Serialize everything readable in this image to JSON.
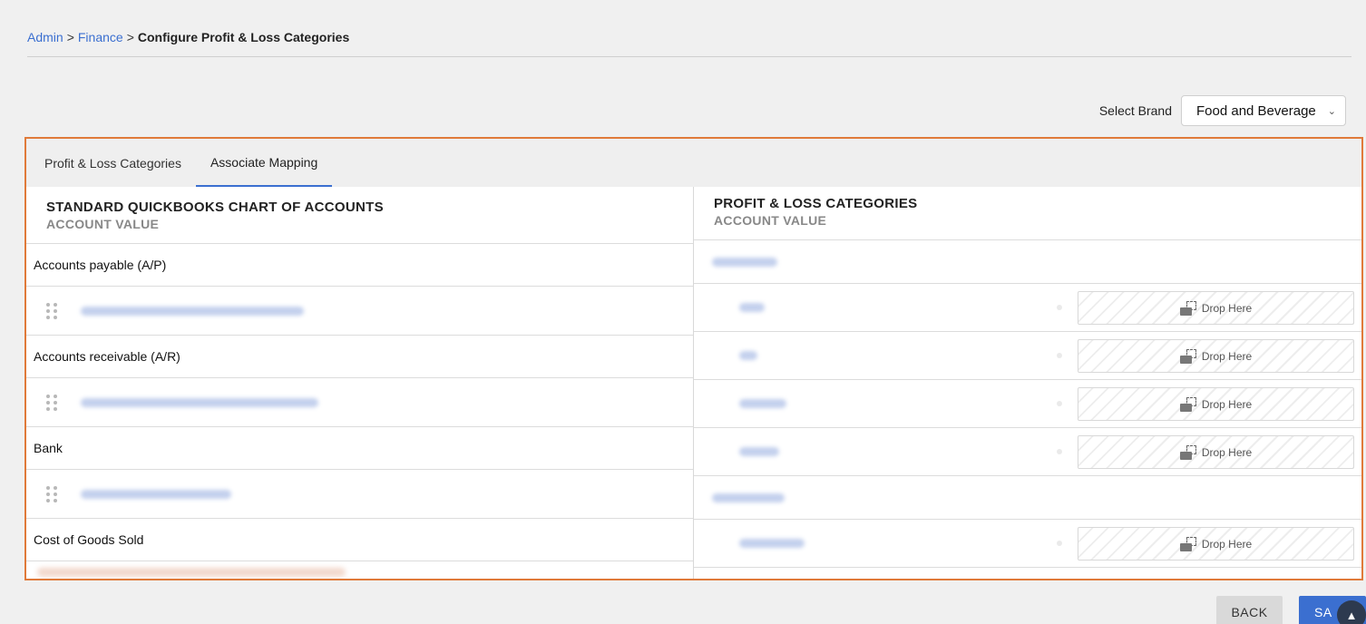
{
  "breadcrumb": {
    "items": [
      "Admin",
      "Finance"
    ],
    "separator": ">",
    "current": "Configure Profit & Loss Categories"
  },
  "brand": {
    "label": "Select Brand",
    "selected": "Food and Beverage"
  },
  "tabs": [
    {
      "label": "Profit & Loss Categories",
      "active": false
    },
    {
      "label": "Associate Mapping",
      "active": true
    }
  ],
  "left": {
    "title": "STANDARD QUICKBOOKS CHART OF ACCOUNTS",
    "subtitle": "ACCOUNT VALUE",
    "groups": [
      "Accounts payable (A/P)",
      "Accounts receivable (A/R)",
      "Bank",
      "Cost of Goods Sold"
    ]
  },
  "right": {
    "title": "PROFIT & LOSS CATEGORIES",
    "subtitle": "ACCOUNT VALUE",
    "drop_label": "Drop Here"
  },
  "buttons": {
    "back": "BACK",
    "save": "SA"
  },
  "colors": {
    "accent": "#3b6fd0",
    "panel_border": "#e07a3a"
  }
}
